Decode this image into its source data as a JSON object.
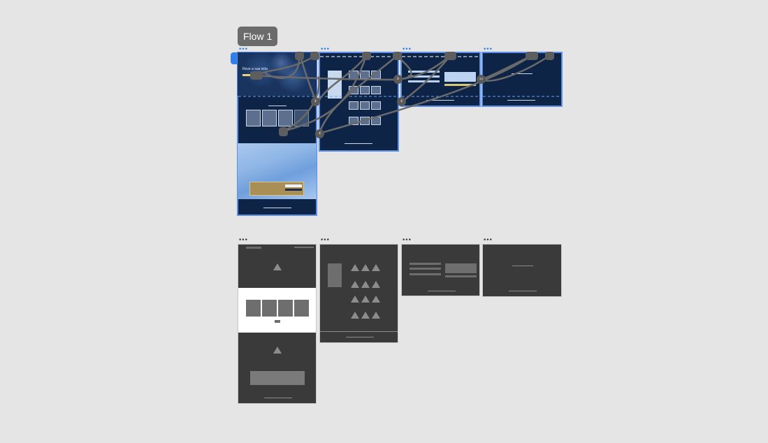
{
  "flow": {
    "label": "Flow 1",
    "colors": {
      "accent": "#2f80ed",
      "artboard_dark": "#0e2447",
      "gold": "#a98f55",
      "wireframe": "#3a3a3a"
    }
  },
  "artboard_menu_icon": "more-dots-icon",
  "nav_icons": {
    "next": "chevron-right-icon",
    "prev": "chevron-left-icon"
  },
  "artboards": {
    "design": [
      {
        "id": "design-home",
        "hero_title": "Reve a sua vida"
      },
      {
        "id": "design-catalog"
      },
      {
        "id": "design-form"
      },
      {
        "id": "design-confirmation"
      }
    ],
    "wireframes": [
      {
        "id": "wire-home"
      },
      {
        "id": "wire-catalog"
      },
      {
        "id": "wire-form"
      },
      {
        "id": "wire-confirmation"
      }
    ]
  },
  "glyphs": {
    "dots": "•••",
    "next": "›",
    "prev": "‹",
    "swap": "‹›"
  }
}
